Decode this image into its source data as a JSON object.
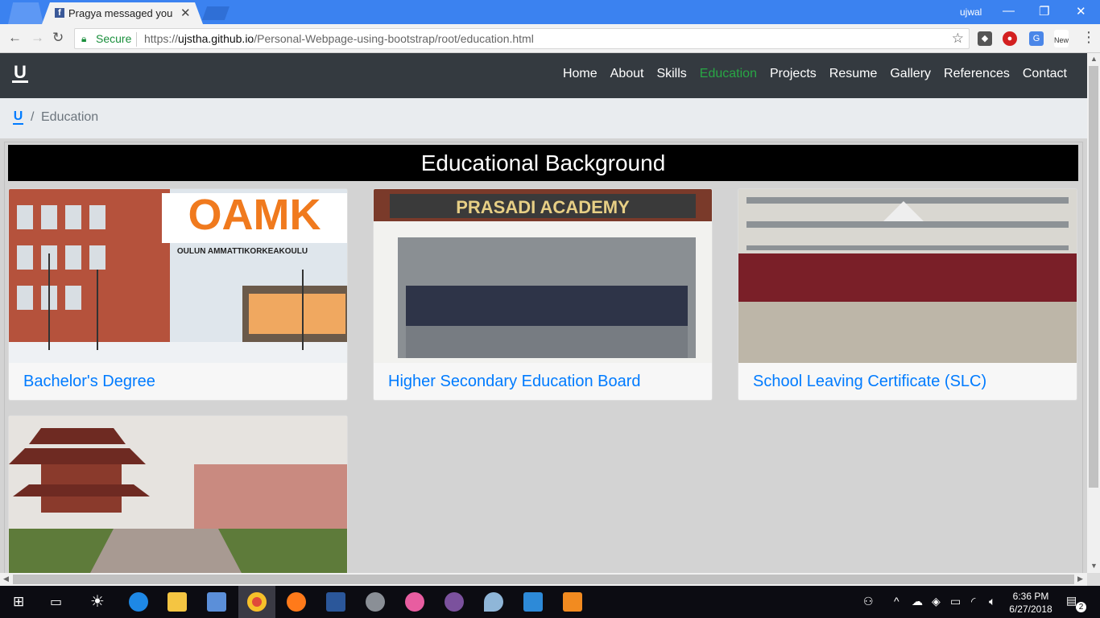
{
  "browser": {
    "tab_title": "Pragya messaged you",
    "tab_close": "✕",
    "user": "ujwal",
    "secure_label": "Secure",
    "url_scheme": "https://",
    "url_host": "ujstha.github.io",
    "url_path": "/Personal-Webpage-using-bootstrap/root/education.html",
    "ext_new_label": "New"
  },
  "site": {
    "brand": "U",
    "nav": [
      "Home",
      "About",
      "Skills",
      "Education",
      "Projects",
      "Resume",
      "Gallery",
      "References",
      "Contact"
    ],
    "active_nav": "Education",
    "breadcrumb_home": "U",
    "breadcrumb_sep": "/",
    "breadcrumb_current": "Education",
    "heading": "Educational Background",
    "cards": [
      {
        "title": "Bachelor's Degree",
        "image_text_1": "OAMK",
        "image_text_2": "OULUN AMMATTIKORKEAKOULU"
      },
      {
        "title": "Higher Secondary Education Board",
        "image_text_1": "PRASADI ACADEMY"
      },
      {
        "title": "School Leaving Certificate (SLC)"
      },
      {
        "title": ""
      }
    ]
  },
  "taskbar": {
    "time": "6:36 PM",
    "date": "6/27/2018",
    "notifications": "2"
  },
  "colors": {
    "navbar": "#343a40",
    "active_nav": "#28a745",
    "link": "#007bff",
    "chrome_title": "#3b82f0"
  }
}
